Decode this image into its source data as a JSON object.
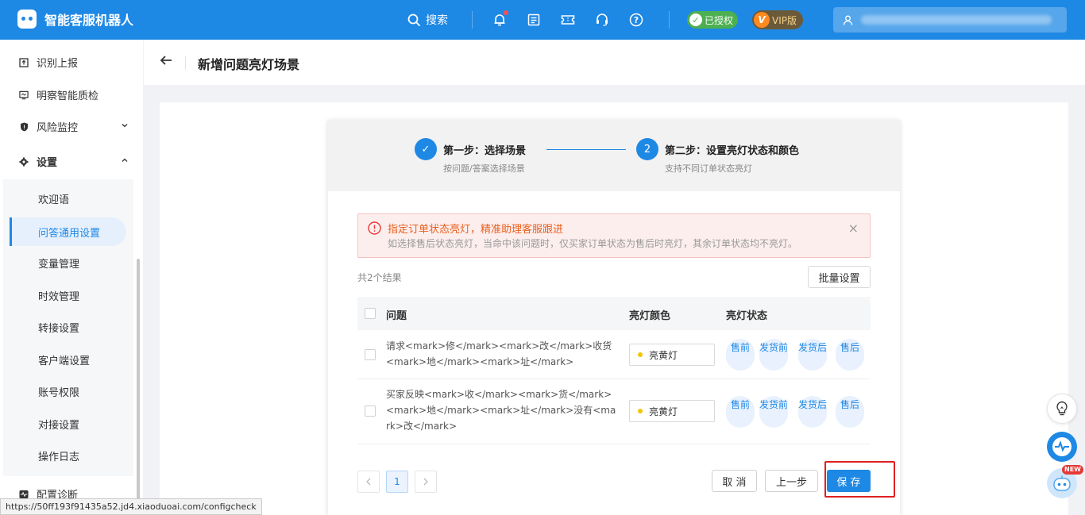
{
  "topbar": {
    "app_title": "智能客服机器人",
    "search_label": "搜索",
    "auth_badge": "已授权",
    "vip_badge": "VIP版",
    "vip_letter": "V",
    "auth_letter": "✓"
  },
  "sidebar": {
    "items": [
      {
        "label": "识别上报"
      },
      {
        "label": "明察智能质检"
      },
      {
        "label": "风险监控"
      },
      {
        "label": "设置"
      }
    ],
    "sub_items": [
      "欢迎语",
      "问答通用设置",
      "变量管理",
      "时效管理",
      "转接设置",
      "客户端设置",
      "账号权限",
      "对接设置",
      "操作日志"
    ],
    "bottom_item": "配置诊断"
  },
  "page": {
    "title": "新增问题亮灯场景"
  },
  "steps": [
    {
      "index": "✓",
      "title": "第一步：选择场景",
      "desc": "按问题/答案选择场景"
    },
    {
      "index": "2",
      "title": "第二步：设置亮灯状态和颜色",
      "desc": "支持不同订单状态亮灯"
    }
  ],
  "alert": {
    "title": "指定订单状态亮灯，精准助理客服跟进",
    "desc": "如选择售后状态亮灯，当命中该问题时，仅买家订单状态为售后时亮灯，其余订单状态均不亮灯。"
  },
  "table": {
    "count_text": "共2个结果",
    "batch_label": "批量设置",
    "headers": {
      "question": "问题",
      "color": "亮灯颜色",
      "status": "亮灯状态"
    },
    "rows": [
      {
        "question": "请求<mark>修</mark><mark>改</mark>收货<mark>地</mark><mark>址</mark>",
        "color": "亮黄灯",
        "statuses": [
          "售前",
          "发货前",
          "发货后",
          "售后"
        ]
      },
      {
        "question": "买家反映<mark>收</mark><mark>货</mark><mark>地</mark><mark>址</mark>没有<mark>改</mark>",
        "color": "亮黄灯",
        "statuses": [
          "售前",
          "发货前",
          "发货后",
          "售后"
        ]
      }
    ]
  },
  "pagination": {
    "current": "1"
  },
  "actions": {
    "cancel": "取 消",
    "prev": "上一步",
    "save": "保 存"
  },
  "float": {
    "new_badge": "NEW"
  },
  "status_bar_url": "https://50ff193f91435a52.jd4.xiaoduoai.com/configcheck",
  "colors": {
    "primary": "#1e88e5",
    "alert_text": "#e8601e",
    "highlight": "#e02020",
    "yellow_light": "#f5c400"
  }
}
